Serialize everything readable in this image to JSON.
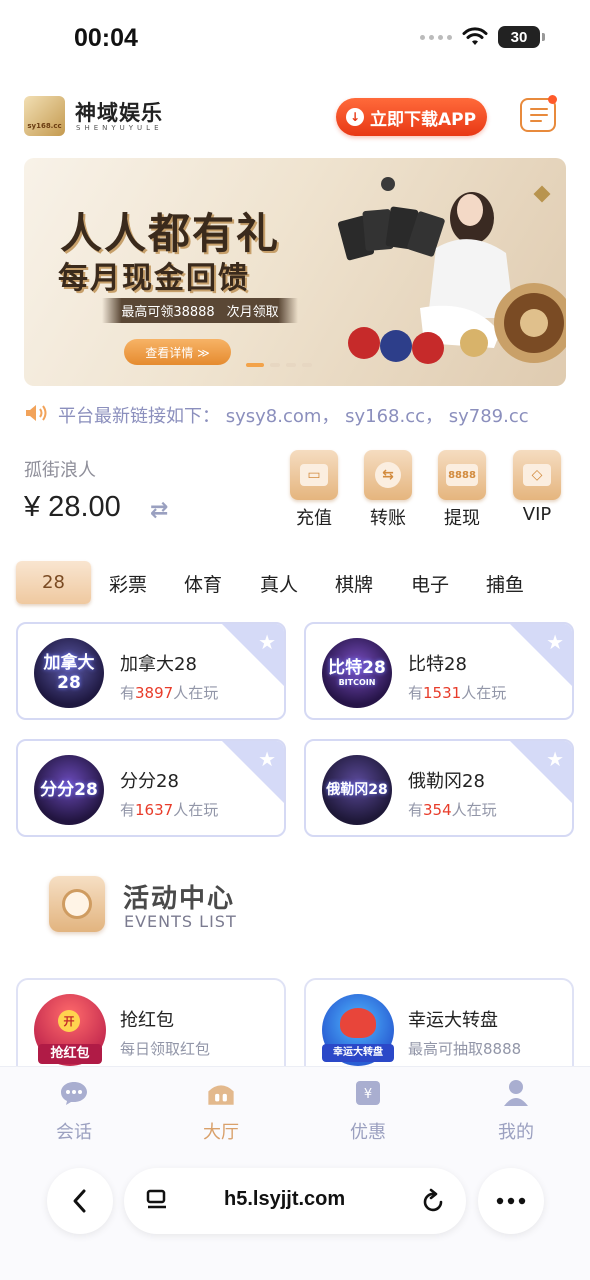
{
  "status_bar": {
    "time": "00:04",
    "battery": "30"
  },
  "header": {
    "brand_name": "神域娱乐",
    "brand_sub": "SHENYUYULE",
    "logo_text": "sy168.cc",
    "download_label": "立即下载APP"
  },
  "banner": {
    "title": "人人都有礼",
    "title2": "每月现金回馈",
    "ribbon_left": "最高可领38888",
    "ribbon_right": "次月领取",
    "cta": "查看详情 ≫"
  },
  "marquee": {
    "text": "平台最新链接如下：  sysy8.com，  sy168.cc，  sy789.cc"
  },
  "wallet": {
    "username": "孤街浪人",
    "balance": "¥ 28.00"
  },
  "quick_actions": [
    {
      "label": "充值",
      "icon": "wallet-icon"
    },
    {
      "label": "转账",
      "icon": "transfer-icon"
    },
    {
      "label": "提现",
      "icon": "withdraw-icon",
      "code": "8888"
    },
    {
      "label": "VIP",
      "icon": "vip-diamond-icon"
    }
  ],
  "tabs": [
    "28",
    "彩票",
    "体育",
    "真人",
    "棋牌",
    "电子",
    "捕鱼"
  ],
  "games": [
    {
      "name": "加拿大28",
      "logo": "加拿大28",
      "prefix": "有",
      "count": "3897",
      "suffix": "人在玩"
    },
    {
      "name": "比特28",
      "logo": "比特28",
      "logo_sub": "BITCOIN",
      "prefix": "有",
      "count": "1531",
      "suffix": "人在玩"
    },
    {
      "name": "分分28",
      "logo": "分分28",
      "prefix": "有",
      "count": "1637",
      "suffix": "人在玩"
    },
    {
      "name": "俄勒冈28",
      "logo": "俄勒冈28",
      "prefix": "有",
      "count": "354",
      "suffix": "人在玩"
    }
  ],
  "events": {
    "title": "活动中心",
    "subtitle": "EVENTS LIST",
    "items": [
      {
        "name": "抢红包",
        "desc": "每日领取红包",
        "logo": "抢红包",
        "badge": "开"
      },
      {
        "name": "幸运大转盘",
        "desc": "最高可抽取8888",
        "logo": "幸运大转盘"
      }
    ]
  },
  "tabbar": [
    {
      "label": "会话",
      "icon": "chat-icon",
      "active": false
    },
    {
      "label": "大厅",
      "icon": "lobby-icon",
      "active": true
    },
    {
      "label": "优惠",
      "icon": "promo-icon",
      "active": false
    },
    {
      "label": "我的",
      "icon": "profile-icon",
      "active": false
    }
  ],
  "browser": {
    "url": "h5.lsyjjt.com"
  },
  "colors": {
    "accent": "#e83815",
    "gold": "#d9a06a",
    "muted": "#9ba0c0",
    "highlight": "#e83c2a"
  }
}
